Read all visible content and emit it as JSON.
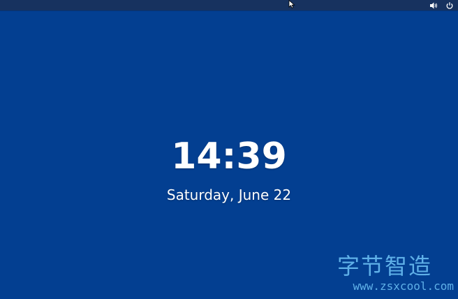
{
  "lock_screen": {
    "time": "14:39",
    "date": "Saturday, June 22"
  },
  "top_bar": {
    "status_icons": [
      "volume-icon",
      "power-icon"
    ],
    "background_color": "#17325f"
  },
  "desktop": {
    "background_color": "#033f91"
  },
  "watermark": {
    "logo_text": "字节智造",
    "url": "www.zsxcool.com"
  },
  "colors": {
    "text": "#ffffff",
    "watermark": "#5fb0e8"
  }
}
